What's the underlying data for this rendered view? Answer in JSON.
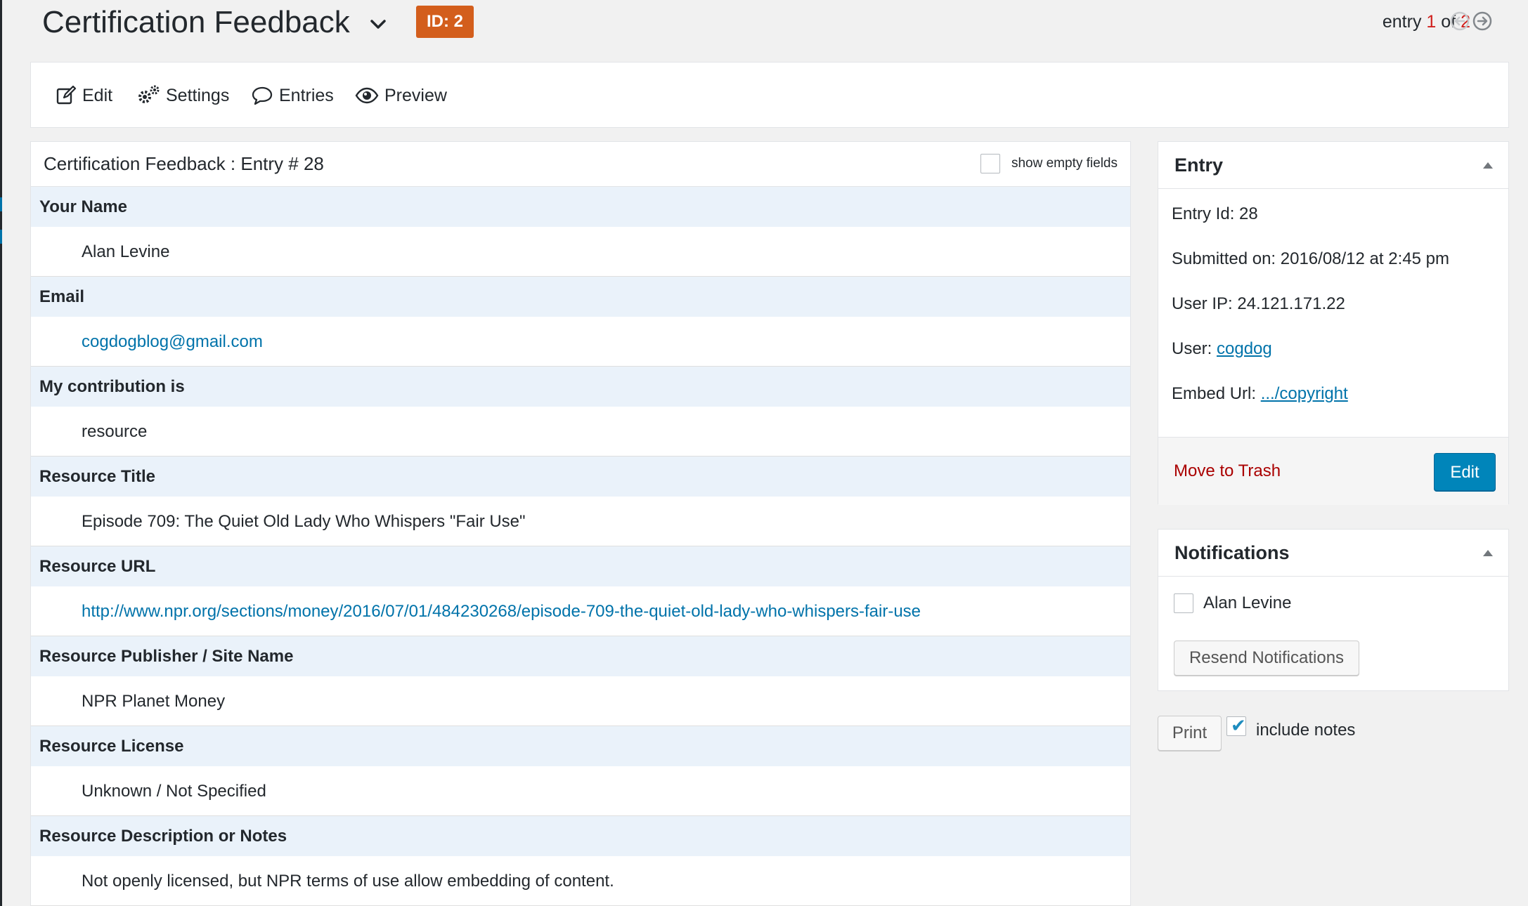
{
  "header": {
    "title": "Certification Feedback",
    "id_badge": "ID: 2",
    "nav_prefix": "entry",
    "nav_current": "1",
    "nav_of": "of",
    "nav_total": "2"
  },
  "toolbar": {
    "edit": "Edit",
    "settings": "Settings",
    "entries": "Entries",
    "preview": "Preview"
  },
  "entry": {
    "heading": "Certification Feedback : Entry # 28",
    "show_empty_label": "show empty fields",
    "fields": [
      {
        "label": "Your Name",
        "value": "Alan Levine"
      },
      {
        "label": "Email",
        "value": "cogdogblog@gmail.com"
      },
      {
        "label": "My contribution is",
        "value": "resource"
      },
      {
        "label": "Resource Title",
        "value": "Episode 709: The Quiet Old Lady Who Whispers \"Fair Use\""
      },
      {
        "label": "Resource URL",
        "value": "http://www.npr.org/sections/money/2016/07/01/484230268/episode-709-the-quiet-old-lady-who-whispers-fair-use"
      },
      {
        "label": "Resource Publisher / Site Name",
        "value": "NPR Planet Money"
      },
      {
        "label": "Resource License",
        "value": "Unknown / Not Specified"
      },
      {
        "label": "Resource Description or Notes",
        "value": "Not openly licensed, but NPR terms of use allow embedding of content."
      }
    ]
  },
  "entry_meta": {
    "title": "Entry",
    "entry_id": "Entry Id: 28",
    "submitted": "Submitted on: 2016/08/12 at 2:45 pm",
    "user_ip": "User IP: 24.121.171.22",
    "user_label": "User:",
    "user_value": "cogdog",
    "embed_label": "Embed Url:",
    "embed_value": ".../copyright",
    "trash": "Move to Trash",
    "edit": "Edit"
  },
  "notifications": {
    "title": "Notifications",
    "recipient": "Alan Levine",
    "resend": "Resend Notifications"
  },
  "print": {
    "button": "Print",
    "include_notes": "include notes",
    "include_notes_checked": true
  },
  "colors": {
    "accent": "#0073aa",
    "badge": "#d35e1c",
    "danger": "#a00",
    "label_bg": "#eaf2fa"
  }
}
